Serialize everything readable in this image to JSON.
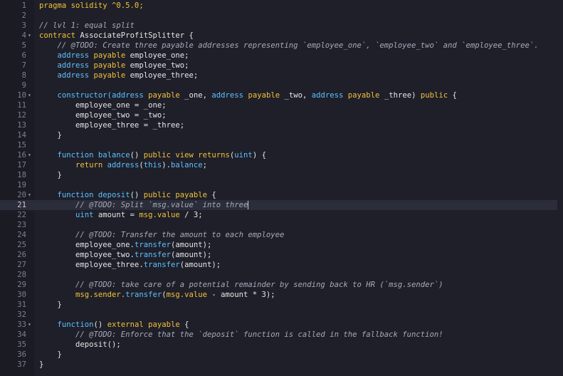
{
  "editor": {
    "language": "solidity",
    "active_line": 21,
    "lines": [
      {
        "n": "1",
        "fold": false,
        "tokens": [
          [
            "kw",
            "pragma solidity ^0.5.0;"
          ]
        ]
      },
      {
        "n": "2",
        "fold": false,
        "tokens": []
      },
      {
        "n": "3",
        "fold": false,
        "tokens": [
          [
            "cm",
            "// lvl 1: equal split"
          ]
        ]
      },
      {
        "n": "4",
        "fold": true,
        "tokens": [
          [
            "kw",
            "contract "
          ],
          [
            "id",
            "AssociateProfitSplitter {"
          ]
        ]
      },
      {
        "n": "5",
        "fold": false,
        "tokens": [
          [
            "cm",
            "    // @TODO: Create three payable addresses representing `employee_one`, `employee_two` and `employee_three`."
          ]
        ]
      },
      {
        "n": "6",
        "fold": false,
        "tokens": [
          [
            "fn",
            "    address "
          ],
          [
            "kw",
            "payable "
          ],
          [
            "id",
            "employee_one;"
          ]
        ]
      },
      {
        "n": "7",
        "fold": false,
        "tokens": [
          [
            "fn",
            "    address "
          ],
          [
            "kw",
            "payable "
          ],
          [
            "id",
            "employee_two;"
          ]
        ]
      },
      {
        "n": "8",
        "fold": false,
        "tokens": [
          [
            "fn",
            "    address "
          ],
          [
            "kw",
            "payable "
          ],
          [
            "id",
            "employee_three;"
          ]
        ]
      },
      {
        "n": "9",
        "fold": false,
        "tokens": []
      },
      {
        "n": "10",
        "fold": true,
        "tokens": [
          [
            "fn",
            "    constructor("
          ],
          [
            "fn",
            "address "
          ],
          [
            "kw",
            "payable "
          ],
          [
            "id",
            "_one, "
          ],
          [
            "fn",
            "address "
          ],
          [
            "kw",
            "payable "
          ],
          [
            "id",
            "_two, "
          ],
          [
            "fn",
            "address "
          ],
          [
            "kw",
            "payable "
          ],
          [
            "id",
            "_three) "
          ],
          [
            "kw",
            "public "
          ],
          [
            "id",
            "{"
          ]
        ]
      },
      {
        "n": "11",
        "fold": false,
        "tokens": [
          [
            "id",
            "        employee_one = _one;"
          ]
        ]
      },
      {
        "n": "12",
        "fold": false,
        "tokens": [
          [
            "id",
            "        employee_two = _two;"
          ]
        ]
      },
      {
        "n": "13",
        "fold": false,
        "tokens": [
          [
            "id",
            "        employee_three = _three;"
          ]
        ]
      },
      {
        "n": "14",
        "fold": false,
        "tokens": [
          [
            "id",
            "    }"
          ]
        ]
      },
      {
        "n": "15",
        "fold": false,
        "tokens": []
      },
      {
        "n": "16",
        "fold": true,
        "tokens": [
          [
            "fn",
            "    function "
          ],
          [
            "fn",
            "balance"
          ],
          [
            "id",
            "() "
          ],
          [
            "kw",
            "public view returns"
          ],
          [
            "id",
            "("
          ],
          [
            "fn",
            "uint"
          ],
          [
            "id",
            ") {"
          ]
        ]
      },
      {
        "n": "17",
        "fold": false,
        "tokens": [
          [
            "kw",
            "        return "
          ],
          [
            "fn",
            "address"
          ],
          [
            "id",
            "("
          ],
          [
            "fn",
            "this"
          ],
          [
            "id",
            ")."
          ],
          [
            "fn",
            "balance"
          ],
          [
            "id",
            ";"
          ]
        ]
      },
      {
        "n": "18",
        "fold": false,
        "tokens": [
          [
            "id",
            "    }"
          ]
        ]
      },
      {
        "n": "19",
        "fold": false,
        "tokens": []
      },
      {
        "n": "20",
        "fold": true,
        "tokens": [
          [
            "fn",
            "    function "
          ],
          [
            "fn",
            "deposit"
          ],
          [
            "id",
            "() "
          ],
          [
            "kw",
            "public payable "
          ],
          [
            "id",
            "{"
          ]
        ]
      },
      {
        "n": "21",
        "fold": false,
        "tokens": [
          [
            "cm",
            "        // @TODO: Split `msg.value` into three"
          ]
        ],
        "caret": true
      },
      {
        "n": "22",
        "fold": false,
        "tokens": [
          [
            "fn",
            "        uint "
          ],
          [
            "id",
            "amount = "
          ],
          [
            "kw",
            "msg.value"
          ],
          [
            "id",
            " / 3;"
          ]
        ]
      },
      {
        "n": "23",
        "fold": false,
        "tokens": []
      },
      {
        "n": "24",
        "fold": false,
        "tokens": [
          [
            "cm",
            "        // @TODO: Transfer the amount to each employee"
          ]
        ]
      },
      {
        "n": "25",
        "fold": false,
        "tokens": [
          [
            "id",
            "        employee_one."
          ],
          [
            "fn",
            "transfer"
          ],
          [
            "id",
            "(amount);"
          ]
        ]
      },
      {
        "n": "26",
        "fold": false,
        "tokens": [
          [
            "id",
            "        employee_two."
          ],
          [
            "fn",
            "transfer"
          ],
          [
            "id",
            "(amount);"
          ]
        ]
      },
      {
        "n": "27",
        "fold": false,
        "tokens": [
          [
            "id",
            "        employee_three."
          ],
          [
            "fn",
            "transfer"
          ],
          [
            "id",
            "(amount);"
          ]
        ]
      },
      {
        "n": "28",
        "fold": false,
        "tokens": []
      },
      {
        "n": "29",
        "fold": false,
        "tokens": [
          [
            "cm",
            "        // @TODO: take care of a potential remainder by sending back to HR (`msg.sender`)"
          ]
        ]
      },
      {
        "n": "30",
        "fold": false,
        "tokens": [
          [
            "kw",
            "        msg.sender."
          ],
          [
            "fn",
            "transfer"
          ],
          [
            "id",
            "("
          ],
          [
            "kw",
            "msg.value"
          ],
          [
            "id",
            " - amount * 3);"
          ]
        ]
      },
      {
        "n": "31",
        "fold": false,
        "tokens": [
          [
            "id",
            "    }"
          ]
        ]
      },
      {
        "n": "32",
        "fold": false,
        "tokens": []
      },
      {
        "n": "33",
        "fold": true,
        "tokens": [
          [
            "fn",
            "    function"
          ],
          [
            "id",
            "() "
          ],
          [
            "kw",
            "external payable "
          ],
          [
            "id",
            "{"
          ]
        ]
      },
      {
        "n": "34",
        "fold": false,
        "tokens": [
          [
            "cm",
            "        // @TODO: Enforce that the `deposit` function is called in the fallback function!"
          ]
        ]
      },
      {
        "n": "35",
        "fold": false,
        "tokens": [
          [
            "id",
            "        deposit();"
          ]
        ]
      },
      {
        "n": "36",
        "fold": false,
        "tokens": [
          [
            "id",
            "    }"
          ]
        ]
      },
      {
        "n": "37",
        "fold": false,
        "tokens": [
          [
            "id",
            "}"
          ]
        ]
      }
    ]
  },
  "colors": {
    "background": "#1e1f29",
    "gutter": "#1a1b23",
    "keyword": "#f3c13a",
    "builtin": "#5ec0ff",
    "comment": "#a7aab9",
    "text": "#e6e6e6",
    "line_number": "#7c7f92",
    "active_line": "#2b2d3a"
  },
  "icons": {
    "fold": "chevron-down-icon"
  },
  "fold_glyph": "▾"
}
